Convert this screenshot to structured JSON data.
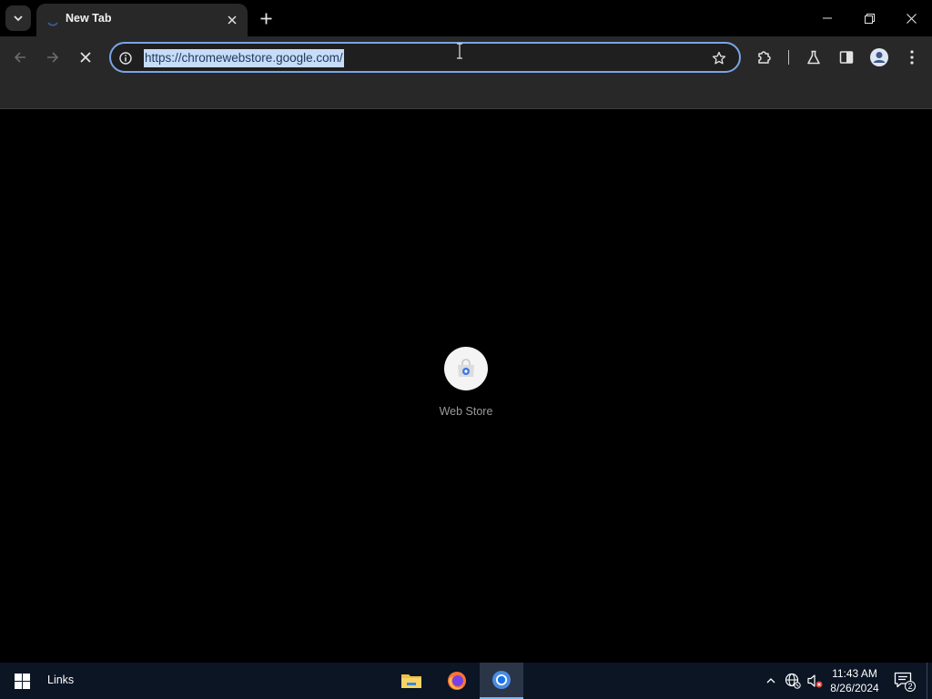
{
  "browser": {
    "tab": {
      "title": "New Tab"
    },
    "omnibox": {
      "url": "https://chromewebstore.google.com/"
    }
  },
  "page": {
    "shortcuts": [
      {
        "label": "Web Store",
        "icon": "web-store-icon"
      }
    ]
  },
  "taskbar": {
    "links_label": "Links",
    "apps": [
      "file-explorer-icon",
      "firefox-icon",
      "chrome-icon"
    ],
    "clock": {
      "time": "11:43 AM",
      "date": "8/26/2024"
    },
    "notifications_count": "2"
  },
  "colors": {
    "accent": "#7aa5e6",
    "url_highlight": "#c6dcf9",
    "taskbar_bg": "#0b1524",
    "toolbar_bg": "#282828"
  }
}
